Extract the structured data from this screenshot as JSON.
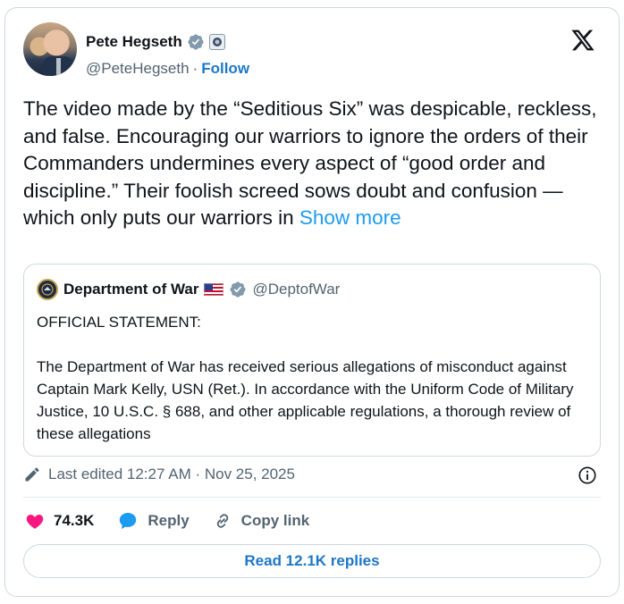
{
  "author": {
    "name": "Pete Hegseth",
    "handle": "@PeteHegseth",
    "separator": "·",
    "follow_label": "Follow"
  },
  "tweet": {
    "text": "The video made by the “Seditious Six” was despicable, reckless, and false. Encouraging our warriors to ignore the orders of their Commanders undermines every aspect of “good order and discipline.” Their foolish screed sows doubt and confusion — which only puts our warriors in ",
    "show_more_label": "Show more"
  },
  "quote": {
    "name": "Department of War",
    "handle": "@DeptofWar",
    "heading": "OFFICIAL STATEMENT:",
    "body": "The Department of War has received serious allegations of misconduct against Captain Mark Kelly, USN (Ret.). In accordance with the Uniform Code of Military Justice, 10 U.S.C. § 688, and other applicable regulations, a thorough review of these allegations"
  },
  "meta": {
    "edited_text": "Last edited 12:27 AM · Nov 25, 2025"
  },
  "actions": {
    "likes": "74.3K",
    "reply_label": "Reply",
    "copy_link_label": "Copy link",
    "read_replies_label": "Read 12.1K replies"
  },
  "colors": {
    "link": "#1d9bf0",
    "follow": "#1d77c8",
    "like": "#f91880",
    "reply": "#1d9bf0",
    "verified": "#829aab",
    "muted": "#536471",
    "border": "#cfd9de"
  },
  "icons": [
    "x-logo-icon",
    "verified-badge-icon",
    "organization-badge-icon",
    "us-flag-icon",
    "dept-seal-icon",
    "pencil-icon",
    "info-icon",
    "heart-icon",
    "reply-bubble-icon",
    "link-icon"
  ]
}
